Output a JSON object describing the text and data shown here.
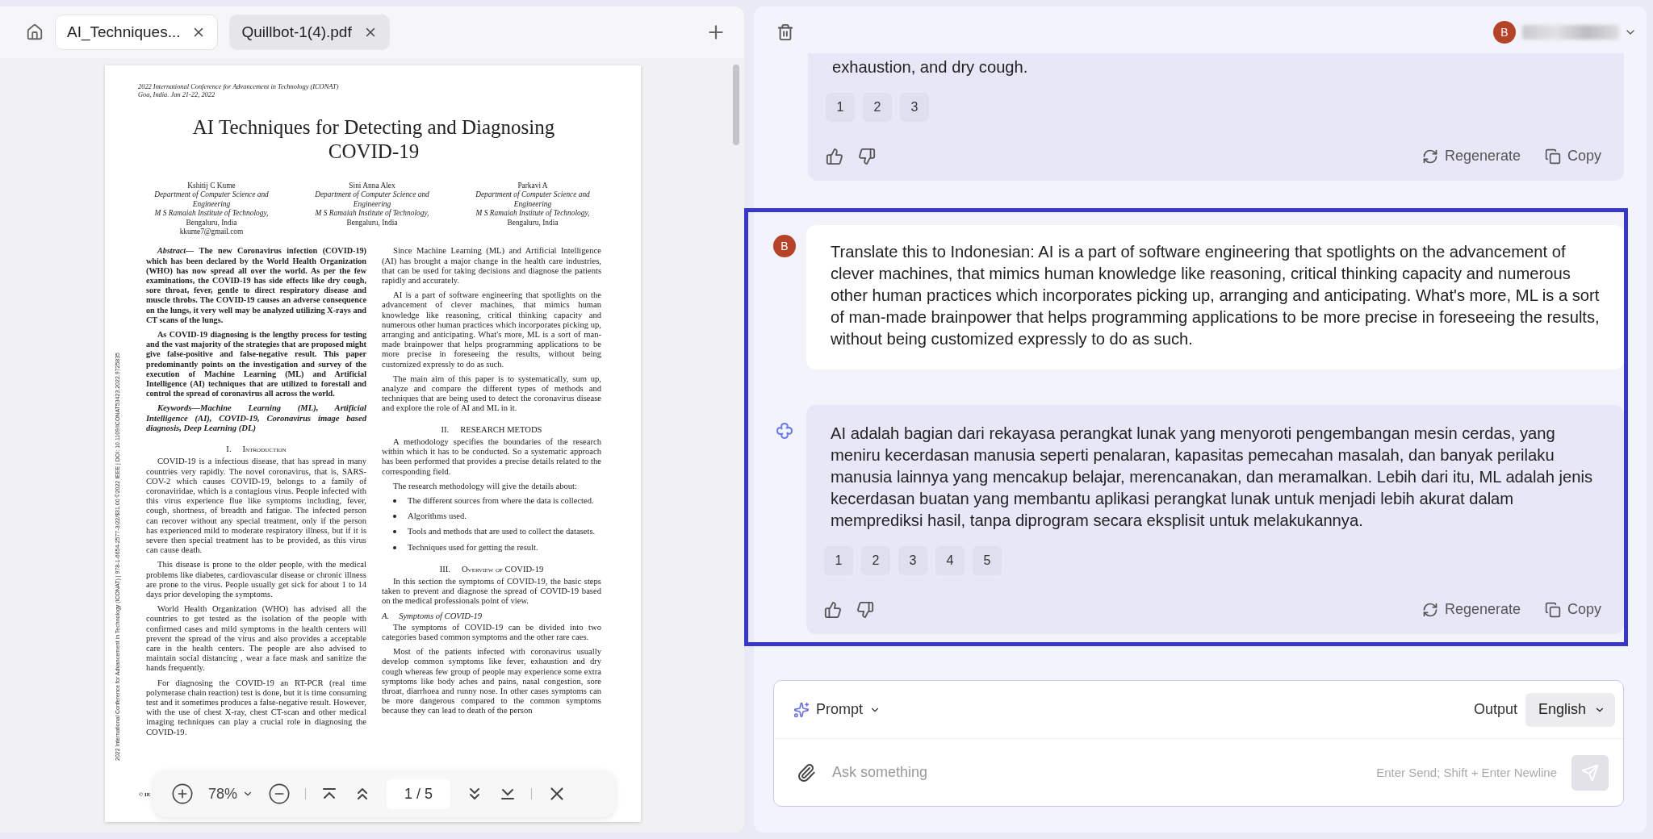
{
  "pdf_viewer": {
    "tabs": [
      {
        "label": "AI_Techniques...",
        "selected": true
      },
      {
        "label": "Quillbot-1(4).pdf",
        "selected": false
      }
    ],
    "document": {
      "margin_note": "2022 International Conference for Advancement in Technology (ICONAT) | 978-1-6654-2577-3/22/$31.00 ©2022 IEEE | DOI: 10.1109/ICONAT53423.2022.9725835",
      "conference": [
        "2022 International Conference for Advancement in Technology (ICONAT)",
        "Goa, India. Jan 21-22, 2022"
      ],
      "title": [
        "AI Techniques for Detecting and Diagnosing",
        "COVID-19"
      ],
      "authors": [
        {
          "name": "Kshitij C Kume",
          "department": "Department of Computer Science and Engineering",
          "institute": "M S Ramaiah Institute of Technology,",
          "location": "Bengaluru, India",
          "email": "kkume7@gmail.com"
        },
        {
          "name": "Sini Anna Alex",
          "department": "Department of Computer Science and Engineering",
          "institute": "M S Ramaiah Institute of Technology,",
          "location": "Bengaluru, India"
        },
        {
          "name": "Parkavi A",
          "department": "Department of Computer Science and Engineering",
          "institute": "M S Ramaiah Institute of Technology,",
          "location": "Bengaluru, India"
        }
      ],
      "columns": [
        [
          {
            "kind": "bold",
            "text": "*Abstract—* The new Coronavirus infection (COVID-19) which has been declared by the World Health Organization (WHO) has now spread all over the world. As per the few examinations, the COVID-19 has side effects like dry cough, sore throat, fever, gentle to direct respiratory disease and muscle throbs. The COVID-19 causes an adverse consequence on the lungs, it very well may be analyzed utilizing X-rays and CT scans of the lungs."
          },
          {
            "kind": "bold",
            "text": "As COVID-19 diagnosing is the lengthy process for testing and the vast majority of the strategies that are proposed might give false-positive and false-negative result. This paper predominantly points on the investigation and survey of the execution of Machine Learning (ML) and Artificial Intelligence (AI) techniques that are utilized to forestall and control the spread of coronavirus all across the world."
          },
          {
            "kind": "keywords",
            "text": "Keywords—Machine Learning (ML), Artificial Intelligence (AI), COVID-19, Coronavirus image based diagnosis, Deep Learning (DL)"
          },
          {
            "kind": "heading",
            "number": "I.",
            "text": "Introduction",
            "small_caps": true
          },
          {
            "kind": "paragraph",
            "text": "COVID-19 is a infectious disease, that has spread in many countries very rapidly. The novel coronavirus, that is, SARS-COV-2 which causes COVID-19, belongs to a family of coronaviridae, which is a contagious virus. People infected with this virus experience flue like symptoms including, fever, cough, shortness, of breadth and fatigue. The infected person can recover without any special treatment, only if the person has experienced mild to moderate respiratory illness, but if it is severe then special treatment has to be provided, as this virus can cause death."
          },
          {
            "kind": "paragraph",
            "text": "This disease is prone to the older people, with the medical problems like diabetes, cardiovascular disease or chronic illness are prone to the virus. People usually get sick for about 1 to 14 days prior developing the symptoms."
          },
          {
            "kind": "paragraph",
            "text": "World Health Organization (WHO) has advised all the countries to get tested as the isolation of the people with confirmed cases and mild symptoms in the health centers will prevent the spread of the virus and also provides a acceptable care in the health centers. The people are also advised to maintain social distancing , wear a face mask and sanitize the hands frequently."
          },
          {
            "kind": "paragraph",
            "text": "For diagnosing the COVID-19 an RT-PCR (real time polymerase chain reaction) test is done, but it is time consuming test and it sometimes produces a false-negative result. However, with the use of chest X-ray, chest CT-scan and other medical imaging techniques can play a crucial role in diagnosing the COVID-19."
          }
        ],
        [
          {
            "kind": "paragraph",
            "text": "Since Machine Learning (ML) and Artificial Intelligence (AI) has brought a major change in the health care industries, that can be used for taking decisions and diagnose the patients rapidly and accurately."
          },
          {
            "kind": "paragraph",
            "text": "AI is a part of software engineering that spotlights on the advancement of clever machines, that mimics human knowledge like reasoning, critical thinking capacity and numerous other human practices which incorporates picking up, arranging and anticipating. What's more, ML is a sort of man-made brainpower that helps programming applications to be more precise in foreseeing the results, without being customized expressly to do as such."
          },
          {
            "kind": "paragraph",
            "text": "The main aim of this paper is to systematically, sum up, analyze and compare the different types of methods and techniques that are being used to detect the coronavirus disease and explore the role of AI and ML in it."
          },
          {
            "kind": "heading",
            "number": "II.",
            "text": "RESEARCH METODS"
          },
          {
            "kind": "paragraph",
            "text": "A methodology specifies the boundaries of the research within which it has to be conducted. So a systematic approach has been performed that provides a precise details related to the corresponding field."
          },
          {
            "kind": "paragraph",
            "text": "The research methodology will give the details about:"
          },
          {
            "kind": "bullets",
            "items": [
              "The different sources from where the data is collected.",
              "Algorithms used.",
              "Tools and methods that are used to collect the datasets.",
              "Techniques used for getting the result."
            ]
          },
          {
            "kind": "heading",
            "number": "III.",
            "text": "Overview of COVID-19",
            "small_caps": true
          },
          {
            "kind": "paragraph",
            "text": "In this section the symptoms of COVID-19, the basic steps taken to prevent and diagnose the spread of COVID-19 based on the medical professionals point of view."
          },
          {
            "kind": "subheading",
            "number": "A.",
            "text": "Symptoms of COVID-19"
          },
          {
            "kind": "paragraph",
            "text": "The symptoms of COVID-19 can be divided into two categories based common symptoms and the other rare caes."
          },
          {
            "kind": "paragraph",
            "text": "Most of the patients infected with coronavirus usually develop common symptoms like fever, exhaustion and dry cough whereas few group of people may experience some extra symptoms like body aches and pains, nasal congestion, sore throat, diarrhoea and runny nose. In other cases symptoms can be more dangerous compared to the common symptoms because they can lead to death of the person"
          }
        ]
      ],
      "footer": "© IE"
    },
    "toolbar": {
      "zoom": "78%",
      "page": "1 / 5"
    }
  },
  "assistant_panel": {
    "user": {
      "avatar": "B"
    },
    "messages": [
      {
        "kind": "assistant",
        "highlighted": false,
        "text": "exhaustion, and dry cough.",
        "sources": [
          "1",
          "2",
          "3"
        ],
        "actions": [
          "Regenerate",
          "Copy"
        ]
      },
      {
        "kind": "user",
        "highlighted": true,
        "avatar": "B",
        "text": "Translate this to Indonesian: AI is a part of software engineering that spotlights on the advancement of clever machines, that mimics human knowledge like reasoning, critical thinking capacity and numerous other human practices which incorporates picking up, arranging and anticipating. What's more, ML is a sort of man-made brainpower that helps programming applications to be more precise in foreseeing the results, without being customized expressly to do as such."
      },
      {
        "kind": "assistant",
        "highlighted": true,
        "text": "AI adalah bagian dari rekayasa perangkat lunak yang menyoroti pengembangan mesin cerdas, yang meniru kecerdasan manusia seperti penalaran, kapasitas pemecahan masalah, dan banyak perilaku manusia lainnya yang mencakup belajar, merencanakan, dan meramalkan. Lebih dari itu, ML adalah jenis kecerdasan buatan yang membantu aplikasi perangkat lunak untuk menjadi lebih akurat dalam memprediksi hasil, tanpa diprogram secara eksplisit untuk melakukannya.",
        "sources": [
          "1",
          "2",
          "3",
          "4",
          "5"
        ],
        "actions": [
          "Regenerate",
          "Copy"
        ]
      }
    ],
    "composer": {
      "mode": "Prompt",
      "output_label": "Output",
      "language": "English",
      "placeholder": "Ask something",
      "hint": "Enter Send; Shift + Enter Newline"
    }
  }
}
